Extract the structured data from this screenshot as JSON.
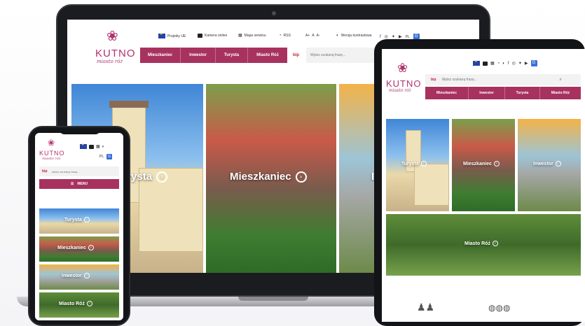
{
  "brand": {
    "name": "KUTNO",
    "tagline": "miasto róż",
    "accent": "#a8325f",
    "rose_icon": "rose-logo-icon"
  },
  "laptop": {
    "utility": {
      "projects": "Projekty UE",
      "camera": "Kamera online",
      "map": "Mapa serwisu",
      "rss": "RSS",
      "font_sizes": [
        "A+",
        "A",
        "A-"
      ],
      "contrast": "Wersja kontrastowa",
      "lang": "PL"
    },
    "nav": [
      "Mieszkaniec",
      "Inwestor",
      "Turysta",
      "Miasto Róż"
    ],
    "bip": "bip",
    "search_placeholder": "Wpisz szukaną frazę...",
    "tiles": [
      "Turysta",
      "Mieszkaniec",
      "I"
    ]
  },
  "tablet": {
    "bip": "bip",
    "search_placeholder": "Wpisz szukaną frazę...",
    "nav": [
      "Mieszkaniec",
      "Inwestor",
      "Turysta",
      "Miasto Róż"
    ],
    "tiles": [
      "Turysta",
      "Mieszkaniec",
      "Inwestor",
      "Miasto Róż"
    ]
  },
  "phone": {
    "lang": "PL",
    "bip": "bip",
    "search_placeholder": "Wpisz szukaną frazę...",
    "menu": "MENU",
    "tiles": [
      "Turysta",
      "Mieszkaniec",
      "Inwestor",
      "Miasto Róż"
    ]
  }
}
